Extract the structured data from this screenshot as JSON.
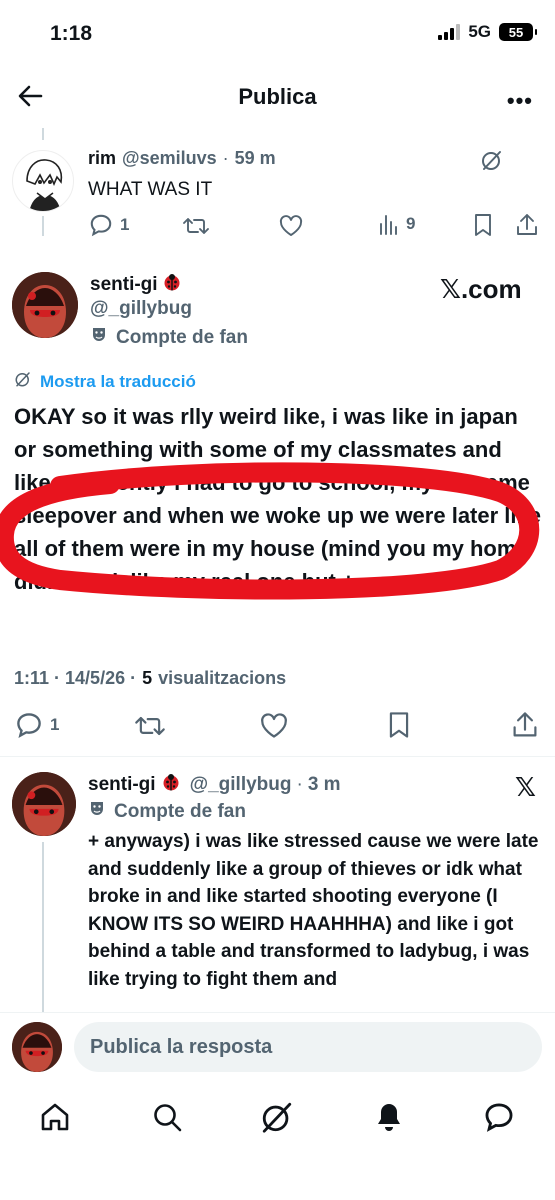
{
  "status_bar": {
    "time": "1:18",
    "network": "5G",
    "battery": "55"
  },
  "header": {
    "title": "Publica"
  },
  "parent_post": {
    "name": "rim",
    "handle": "@semiluvs",
    "time": "59 m",
    "text": "WHAT WAS IT",
    "replies": "1",
    "views": "9"
  },
  "main_post": {
    "name": "senti-gi",
    "handle": "@_gillybug",
    "badge": "Compte de fan",
    "source": "𝕏.com",
    "translate": "Mostra la traducció",
    "text": "OKAY so it was rlly weird like, i was like in japan or something with some of my classmates and like apparently i had to go to school, my bff came sleepover and when we woke up we were later like all of them were in my house (mind you my home didn't look like my real one but +",
    "timestamp": "1:11 · 14/5/26 ·",
    "views_count": "5",
    "views_label": "visualitzacions",
    "replies": "1"
  },
  "reply_post": {
    "name": "senti-gi",
    "handle": "@_gillybug",
    "time": "3 m",
    "badge": "Compte de fan",
    "text": "+ anyways) i was like stressed cause we were late and suddenly like a group of thieves or idk what broke in and like started shooting everyone (I KNOW ITS SO WEIRD HAAHHHA) and like i got behind a table and transformed to ladybug, i was like trying to fight them and"
  },
  "reply_bar": {
    "placeholder": "Publica la resposta"
  },
  "colors": {
    "link": "#1d9bf0",
    "muted": "#536471",
    "highlight": "#e8141e"
  }
}
